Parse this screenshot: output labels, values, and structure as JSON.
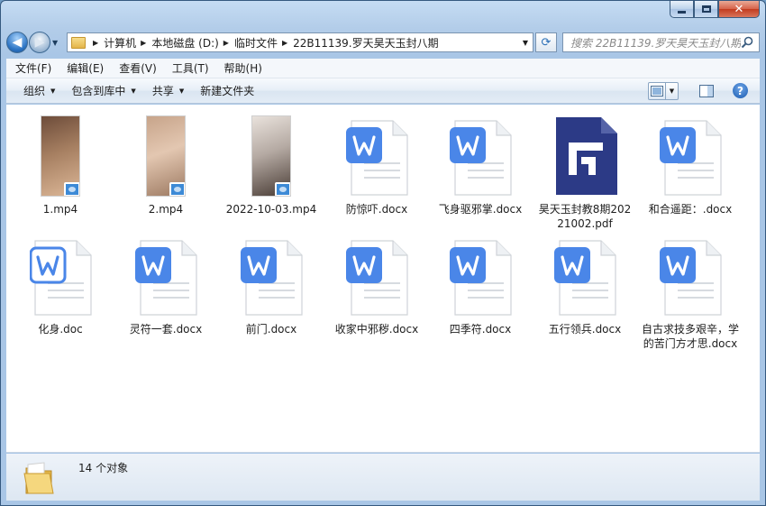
{
  "window": {
    "controls": {
      "minimize": "minimize",
      "maximize": "maximize",
      "close": "✕"
    }
  },
  "address": {
    "crumbs": [
      "计算机",
      "本地磁盘 (D:)",
      "临时文件",
      "22B11139.罗天昊天玉封八期"
    ]
  },
  "search": {
    "placeholder": "搜索 22B11139.罗天昊天玉封八期"
  },
  "menu": [
    "文件(F)",
    "编辑(E)",
    "查看(V)",
    "工具(T)",
    "帮助(H)"
  ],
  "toolbar": {
    "organize": "组织",
    "include": "包含到库中",
    "share": "共享",
    "new_folder": "新建文件夹",
    "help": "?"
  },
  "files": [
    {
      "name": "1.mp4",
      "type": "video",
      "thumb_colors": [
        "#6d4c3a",
        "#a67f61",
        "#dcb797"
      ]
    },
    {
      "name": "2.mp4",
      "type": "video",
      "thumb_colors": [
        "#c7a48a",
        "#e3c7b1",
        "#9d7a62"
      ]
    },
    {
      "name": "2022-10-03.mp4",
      "type": "video",
      "thumb_colors": [
        "#e9e2dc",
        "#b5aaa3",
        "#4a3d36"
      ]
    },
    {
      "name": "防惊吓.docx",
      "type": "docx"
    },
    {
      "name": "飞身驱邪掌.docx",
      "type": "docx"
    },
    {
      "name": "昊天玉封教8期20221002.pdf",
      "type": "pdf"
    },
    {
      "name": "和合遥距：.docx",
      "type": "docx"
    },
    {
      "name": "化身.doc",
      "type": "doc"
    },
    {
      "name": "灵符一套.docx",
      "type": "docx"
    },
    {
      "name": "前门.docx",
      "type": "docx"
    },
    {
      "name": "收家中邪秽.docx",
      "type": "docx"
    },
    {
      "name": "四季符.docx",
      "type": "docx"
    },
    {
      "name": "五行领兵.docx",
      "type": "docx"
    },
    {
      "name": "自古求技多艰辛，学的苦门方才思.docx",
      "type": "docx"
    }
  ],
  "status": {
    "count": "14 个对象"
  },
  "colors": {
    "wps_blue": "#4a86e8",
    "pdf_navy": "#2c3a86",
    "window_frame": "#a9c6e6"
  }
}
